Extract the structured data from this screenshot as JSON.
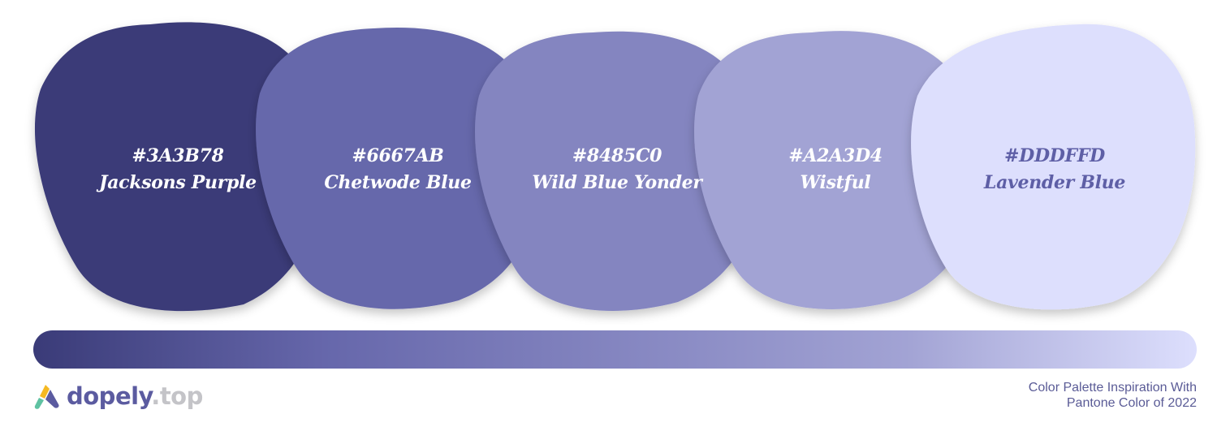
{
  "swatches": [
    {
      "hex": "#3A3B78",
      "name": "Jacksons Purple",
      "color": "#3A3B78",
      "text_color": "#ffffff"
    },
    {
      "hex": "#6667AB",
      "name": "Chetwode Blue",
      "color": "#6667AB",
      "text_color": "#ffffff"
    },
    {
      "hex": "#8485C0",
      "name": "Wild Blue Yonder",
      "color": "#8485C0",
      "text_color": "#ffffff"
    },
    {
      "hex": "#A2A3D4",
      "name": "Wistful",
      "color": "#A2A3D4",
      "text_color": "#ffffff"
    },
    {
      "hex": "#DDDFFD",
      "name": "Lavender Blue",
      "color": "#DDDFFD",
      "text_color": "#5E5FA6"
    }
  ],
  "brand": {
    "name": "dopely",
    "tld": ".top"
  },
  "caption": {
    "line1": "Color Palette Inspiration With",
    "line2": "Pantone Color of 2022"
  }
}
